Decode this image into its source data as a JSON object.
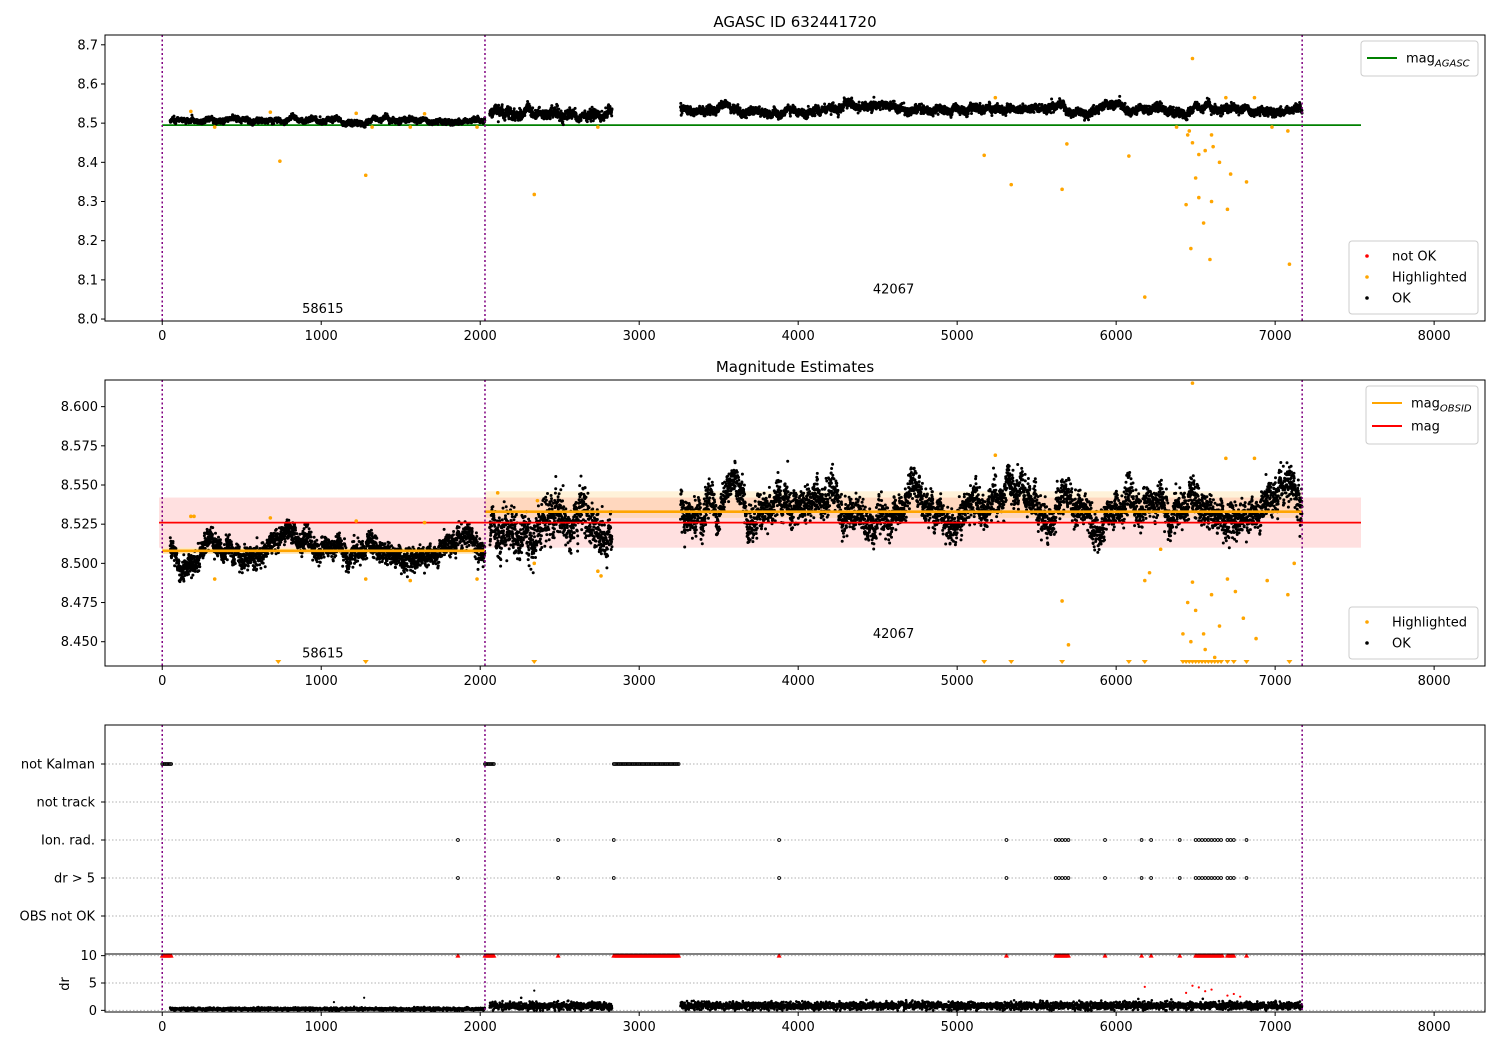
{
  "chart_data": [
    {
      "type": "scatter",
      "title": "AGASC ID 632441720",
      "xlim": [
        -360,
        8320
      ],
      "ylim": [
        7.995,
        8.725
      ],
      "xticks": [
        0,
        1000,
        2000,
        3000,
        4000,
        5000,
        6000,
        7000,
        8000
      ],
      "yticks": [
        8.0,
        8.1,
        8.2,
        8.3,
        8.4,
        8.5,
        8.6,
        8.7
      ],
      "ytick_decimals": 1,
      "obs_boundaries": [
        0,
        2030,
        7170
      ],
      "obs_labels": [
        {
          "text": "58615",
          "x": 1010,
          "y": 8.025
        },
        {
          "text": "42067",
          "x": 4600,
          "y": 8.075
        }
      ],
      "hlines": [
        {
          "name": "mag_AGASC",
          "y": 8.495,
          "x_range": [
            0,
            7540
          ],
          "color": "#008000"
        }
      ],
      "legend_top": [
        {
          "label": "mag",
          "sub": "AGASC",
          "color": "#008000"
        }
      ],
      "legend_bottom": [
        {
          "label": "not OK",
          "color": "#ff0000"
        },
        {
          "label": "Highlighted",
          "color": "#ffa500"
        },
        {
          "label": "OK",
          "color": "#000000"
        }
      ],
      "series": [
        {
          "segment": "OK",
          "x_range": [
            50,
            2030
          ],
          "base": 8.507,
          "noise": 0.005
        },
        {
          "segment": "OK",
          "x_range": [
            2060,
            2830
          ],
          "base": 8.525,
          "noise": 0.01
        },
        {
          "segment": "OK",
          "x_range": [
            3260,
            7170
          ],
          "base": 8.535,
          "noise": 0.008
        }
      ],
      "highlighted": [
        [
          740,
          8.403
        ],
        [
          1280,
          8.367
        ],
        [
          2340,
          8.318
        ],
        [
          5170,
          8.418
        ],
        [
          5340,
          8.343
        ],
        [
          5660,
          8.331
        ],
        [
          6080,
          8.416
        ],
        [
          6180,
          8.056
        ],
        [
          6480,
          8.665
        ],
        [
          6470,
          8.18
        ],
        [
          6590,
          8.152
        ],
        [
          6550,
          8.245
        ],
        [
          6440,
          8.292
        ],
        [
          6500,
          8.36
        ],
        [
          6520,
          8.31
        ],
        [
          6600,
          8.3
        ],
        [
          6700,
          8.28
        ],
        [
          6820,
          8.35
        ],
        [
          7090,
          8.14
        ],
        [
          6450,
          8.47
        ],
        [
          6480,
          8.45
        ],
        [
          6520,
          8.42
        ],
        [
          6560,
          8.43
        ],
        [
          6610,
          8.44
        ],
        [
          6650,
          8.4
        ],
        [
          6720,
          8.37
        ],
        [
          6460,
          8.48
        ],
        [
          6600,
          8.47
        ],
        [
          5690,
          8.447
        ],
        [
          6380,
          8.49
        ],
        [
          6980,
          8.49
        ],
        [
          7080,
          8.48
        ]
      ],
      "highlighted_near": [
        [
          180,
          8.53
        ],
        [
          680,
          8.528
        ],
        [
          1220,
          8.525
        ],
        [
          1650,
          8.524
        ],
        [
          5240,
          8.565
        ],
        [
          6690,
          8.565
        ],
        [
          6870,
          8.565
        ],
        [
          2740,
          8.49
        ],
        [
          1320,
          8.49
        ],
        [
          330,
          8.49
        ],
        [
          1560,
          8.49
        ],
        [
          1980,
          8.49
        ]
      ]
    },
    {
      "type": "scatter",
      "title": "Magnitude Estimates",
      "xlim": [
        -360,
        8320
      ],
      "ylim": [
        8.4345,
        8.617
      ],
      "xticks": [
        0,
        1000,
        2000,
        3000,
        4000,
        5000,
        6000,
        7000,
        8000
      ],
      "yticks": [
        8.45,
        8.475,
        8.5,
        8.525,
        8.55,
        8.575,
        8.6
      ],
      "ytick_decimals": 3,
      "obs_boundaries": [
        0,
        2030,
        7170
      ],
      "obs_labels": [
        {
          "text": "58615",
          "x": 1010,
          "y": 8.4425
        },
        {
          "text": "42067",
          "x": 4600,
          "y": 8.455
        }
      ],
      "hlines": [
        {
          "name": "mag",
          "y": 8.526,
          "x_range": [
            -20,
            7540
          ],
          "color": "#ff0000",
          "band": [
            8.51,
            8.542
          ],
          "band_color": "rgba(255,0,0,0.12)"
        },
        {
          "name": "mag_OBSID",
          "y": 8.508,
          "x_range": [
            0,
            2030
          ],
          "color": "#ffa500",
          "band": [
            8.506,
            8.51
          ],
          "band_color": "rgba(255,165,0,0.25)"
        },
        {
          "name": "mag_OBSID",
          "y": 8.533,
          "x_range": [
            2030,
            7170
          ],
          "color": "#ffa500",
          "band": [
            8.529,
            8.546
          ],
          "band_color": "rgba(255,165,0,0.15)"
        }
      ],
      "legend_top": [
        {
          "label": "mag",
          "sub": "OBSID",
          "color": "#ffa500"
        },
        {
          "label": "mag",
          "sub": "",
          "color": "#ff0000"
        }
      ],
      "legend_bottom": [
        {
          "label": "Highlighted",
          "color": "#ffa500"
        },
        {
          "label": "OK",
          "color": "#000000"
        }
      ],
      "series": [
        {
          "segment": "OK",
          "x_range": [
            50,
            2030
          ],
          "base": 8.507,
          "noise": 0.0055
        },
        {
          "segment": "OK",
          "x_range": [
            2060,
            2830
          ],
          "base": 8.527,
          "noise": 0.011
        },
        {
          "segment": "OK",
          "x_range": [
            3260,
            7170
          ],
          "base": 8.534,
          "noise": 0.0085
        }
      ],
      "highlighted": [
        [
          6450,
          8.475
        ],
        [
          6500,
          8.47
        ],
        [
          6550,
          8.455
        ],
        [
          6600,
          8.48
        ],
        [
          6650,
          8.46
        ],
        [
          6700,
          8.49
        ],
        [
          6750,
          8.482
        ],
        [
          6800,
          8.465
        ],
        [
          6480,
          8.488
        ],
        [
          6560,
          8.445
        ],
        [
          6620,
          8.44
        ],
        [
          6420,
          8.455
        ],
        [
          6470,
          8.45
        ],
        [
          5660,
          8.476
        ],
        [
          5700,
          8.448
        ],
        [
          6180,
          8.489
        ],
        [
          6880,
          8.452
        ],
        [
          6950,
          8.489
        ],
        [
          7080,
          8.48
        ],
        [
          7120,
          8.5
        ],
        [
          2740,
          8.495
        ],
        [
          2760,
          8.492
        ],
        [
          2340,
          8.5
        ],
        [
          1280,
          8.49
        ],
        [
          330,
          8.49
        ],
        [
          1560,
          8.489
        ],
        [
          1980,
          8.49
        ],
        [
          6210,
          8.494
        ],
        [
          6280,
          8.509
        ]
      ],
      "highlighted_near": [
        [
          180,
          8.53
        ],
        [
          200,
          8.53
        ],
        [
          680,
          8.529
        ],
        [
          1220,
          8.527
        ],
        [
          1650,
          8.526
        ],
        [
          5240,
          8.569
        ],
        [
          6690,
          8.567
        ],
        [
          6870,
          8.567
        ],
        [
          6480,
          8.615
        ],
        [
          2110,
          8.545
        ],
        [
          2360,
          8.54
        ]
      ],
      "clipped_markers": [
        730,
        1280,
        2340,
        5170,
        5340,
        5660,
        6080,
        6180,
        6420,
        6440,
        6460,
        6480,
        6500,
        6520,
        6540,
        6560,
        6580,
        6600,
        6620,
        6640,
        6660,
        6700,
        6740,
        6820,
        7090
      ]
    },
    {
      "type": "scatter",
      "title": "",
      "xlim": [
        -360,
        8320
      ],
      "xticks": [
        0,
        1000,
        2000,
        3000,
        4000,
        5000,
        6000,
        7000,
        8000
      ],
      "obs_boundaries": [
        0,
        2030,
        7170
      ],
      "flag_rows": [
        "not Kalman",
        "not track",
        "Ion. rad.",
        "dr > 5",
        "OBS not OK"
      ],
      "flag_points": {
        "not Kalman": [
          [
            0,
            60
          ],
          [
            2030,
            2090
          ],
          [
            2840,
            3250
          ]
        ],
        "not track": [],
        "Ion. rad.": [
          1860,
          2490,
          2840,
          3880,
          5310,
          5620,
          5640,
          5660,
          5680,
          5700,
          5930,
          6160,
          6220,
          6400,
          6500,
          6520,
          6540,
          6560,
          6580,
          6600,
          6620,
          6640,
          6660,
          6700,
          6720,
          6740,
          6820
        ],
        "dr > 5": [
          1860,
          2490,
          2840,
          3880,
          5310,
          5620,
          5640,
          5660,
          5680,
          5700,
          5930,
          6160,
          6220,
          6400,
          6500,
          6520,
          6540,
          6560,
          6580,
          6600,
          6620,
          6640,
          6660,
          6700,
          6720,
          6740,
          6820
        ],
        "OBS not OK": []
      },
      "dr_panel": {
        "ylabel": "dr",
        "ylim": [
          -0.3,
          10.3
        ],
        "yticks": [
          0,
          5,
          10
        ],
        "red_markers_at_10": [
          [
            0,
            60
          ],
          [
            1860
          ],
          [
            2030,
            2090
          ],
          [
            2490
          ],
          [
            2840,
            3250
          ],
          [
            3880
          ],
          [
            5310
          ],
          [
            5620,
            5700
          ],
          [
            5930
          ],
          [
            6160
          ],
          [
            6220
          ],
          [
            6400
          ],
          [
            6500,
            6670
          ],
          [
            6700,
            6740
          ],
          [
            6820
          ]
        ],
        "ok_segments": [
          {
            "x_range": [
              50,
              2030
            ],
            "base": 0.25,
            "noise": 0.12
          },
          {
            "x_range": [
              2060,
              2830
            ],
            "base": 0.8,
            "noise": 0.35
          },
          {
            "x_range": [
              3260,
              7170
            ],
            "base": 0.85,
            "noise": 0.35
          }
        ],
        "outliers": [
          [
            1080,
            1.5
          ],
          [
            1270,
            2.3
          ],
          [
            2340,
            3.6
          ],
          [
            6180,
            4.3
          ],
          [
            6480,
            4.5
          ],
          [
            6520,
            4.2
          ],
          [
            6560,
            3.5
          ],
          [
            6600,
            3.8
          ],
          [
            6440,
            3.2
          ],
          [
            6700,
            2.7
          ],
          [
            6740,
            3.0
          ],
          [
            6780,
            2.5
          ]
        ]
      }
    }
  ]
}
